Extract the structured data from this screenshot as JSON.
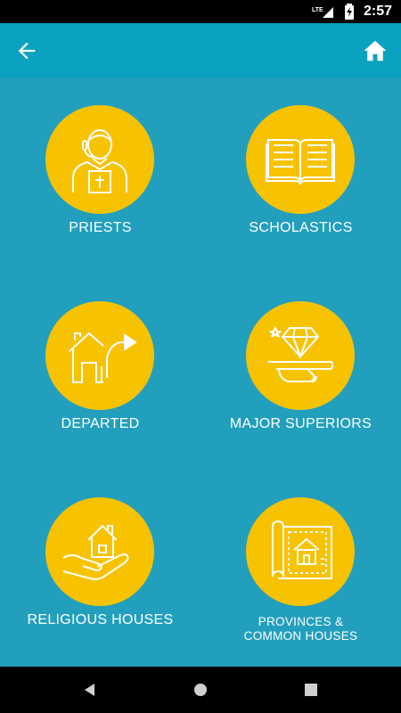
{
  "status_bar": {
    "network": "LTE",
    "time": "2:57"
  },
  "app_bar": {
    "back_icon": "arrow-back-icon",
    "home_icon": "home-icon"
  },
  "tiles": [
    {
      "label": "PRIESTS",
      "icon": "priest-icon"
    },
    {
      "label": "SCHOLASTICS",
      "icon": "open-book-icon"
    },
    {
      "label": "DEPARTED",
      "icon": "house-arrow-icon"
    },
    {
      "label": "MAJOR SUPERIORS",
      "icon": "diamond-tray-icon"
    },
    {
      "label": "RELIGIOUS HOUSES",
      "icon": "hand-house-icon"
    },
    {
      "label_line1": "PROVINCES &",
      "label_line2": "COMMON HOUSES",
      "icon": "blueprint-icon"
    }
  ],
  "nav_bar": {
    "back": "nav-back-icon",
    "home": "nav-home-icon",
    "recents": "nav-recents-icon"
  },
  "colors": {
    "background": "#229fbd",
    "app_bar": "#0aa2c0",
    "circle": "#f7c200",
    "text": "#ffffff"
  }
}
